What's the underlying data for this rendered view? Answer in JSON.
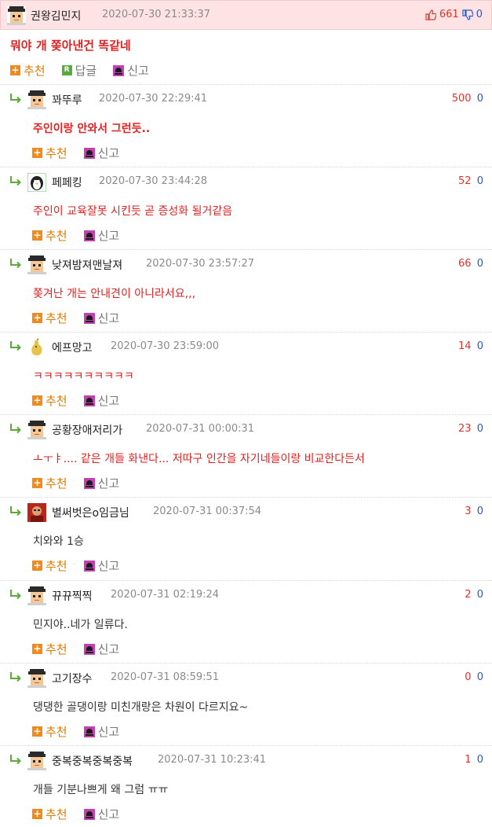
{
  "top": {
    "nick": "권왕김민지",
    "date": "2020-07-30 21:33:37",
    "up": "661",
    "down": "0",
    "body": "뭐야 개 쫒아낸건 똑같네",
    "actions": {
      "recommend": "추천",
      "reply": "답글",
      "report": "신고"
    }
  },
  "replies": [
    {
      "nick": "꽈뚜루",
      "date": "2020-07-30 22:29:41",
      "up": "500",
      "down": "0",
      "body": "주인이랑 안와서 그런듯..",
      "style": "red-bold",
      "avatar": "default-avatar-icon",
      "recommend": "추천",
      "report": "신고"
    },
    {
      "nick": "페페킹",
      "date": "2020-07-30 23:44:28",
      "up": "52",
      "down": "0",
      "body": "주인이 교육잘못 시킨듯 곧 증성화 될거같음",
      "style": "red",
      "avatar": "penguin-avatar-icon",
      "recommend": "추천",
      "report": "신고"
    },
    {
      "nick": "낮져밤져맨날져",
      "date": "2020-07-30 23:57:27",
      "up": "66",
      "down": "0",
      "body": "쫒겨난 개는 안내견이 아니라서요,,,",
      "style": "red",
      "avatar": "default-avatar-icon",
      "recommend": "추천",
      "report": "신고"
    },
    {
      "nick": "에프망고",
      "date": "2020-07-30 23:59:00",
      "up": "14",
      "down": "0",
      "body": "ㅋㅋㅋㅋㅋㅋㅋㅋㅋㅋ",
      "style": "red",
      "avatar": "mango-avatar-icon",
      "recommend": "추천",
      "report": "신고"
    },
    {
      "nick": "공황장애저리가",
      "date": "2020-07-31 00:00:31",
      "up": "23",
      "down": "0",
      "body": "ㅗㅜㅑ.... 같은 개들 화낸다... 저따구 인간을 자기네들이랑 비교한다든서",
      "style": "red",
      "avatar": "default-avatar-icon",
      "recommend": "추천",
      "report": "신고"
    },
    {
      "nick": "별써벗은o임금님",
      "date": "2020-07-31 00:37:54",
      "up": "3",
      "down": "0",
      "body": "치와와 1승",
      "style": "dark",
      "avatar": "photo-avatar-icon",
      "recommend": "추천",
      "report": "신고"
    },
    {
      "nick": "뀨뀨찍찍",
      "date": "2020-07-31 02:19:24",
      "up": "2",
      "down": "0",
      "body": "민지야..네가 일류다.",
      "style": "dark",
      "avatar": "default-avatar-icon",
      "recommend": "추천",
      "report": "신고"
    },
    {
      "nick": "고기장수",
      "date": "2020-07-31 08:59:51",
      "up": "0",
      "down": "0",
      "body": "댕댕한 골댕이랑 미친개랑은 차원이 다르지요~",
      "style": "dark",
      "avatar": "default-avatar-icon",
      "recommend": "추천",
      "report": "신고"
    },
    {
      "nick": "중복중복중복중복",
      "date": "2020-07-31 10:23:41",
      "up": "1",
      "down": "0",
      "body": "개들 기분나쁘게 왜 그럼 ㅠㅠ",
      "style": "dark",
      "avatar": "default-avatar-icon",
      "recommend": "추천",
      "report": "신고"
    }
  ],
  "colors": {
    "up": "#e0342c",
    "down": "#2b59c3",
    "highlight_bg": "#fde3e3",
    "recommend": "#e07a00",
    "body_red": "#e02222"
  }
}
